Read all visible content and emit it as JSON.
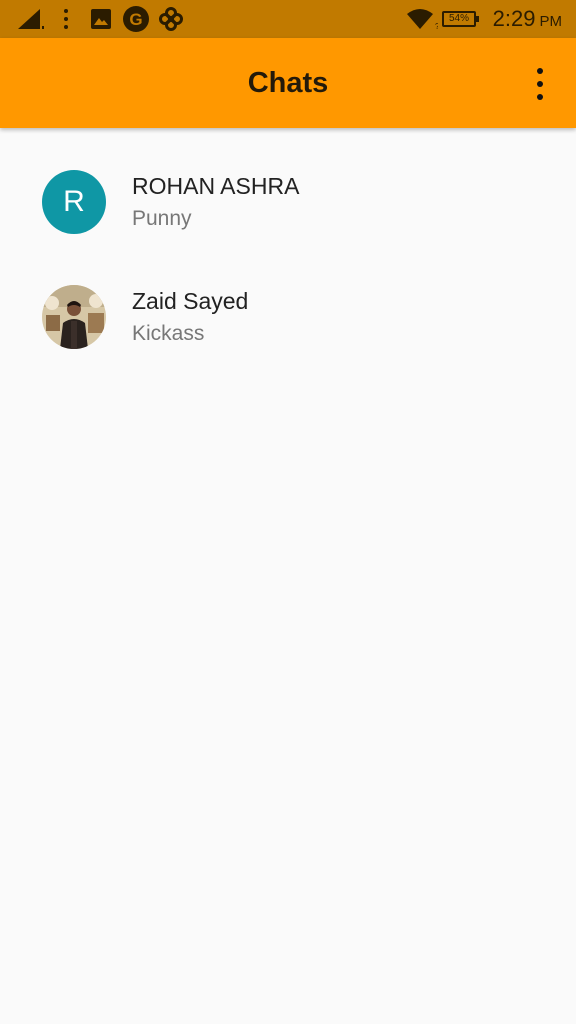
{
  "status_bar": {
    "time": "2:29",
    "ampm": "PM",
    "battery": "54%",
    "icons": [
      "signal-icon",
      "more-vert-icon",
      "image-icon",
      "google-icon",
      "pinwheel-icon",
      "wifi-icon",
      "battery-icon"
    ]
  },
  "app_bar": {
    "title": "Chats",
    "menu_icon": "overflow-menu-icon"
  },
  "chats": [
    {
      "name": "ROHAN ASHRA",
      "subtitle": "Punny",
      "avatar_type": "letter",
      "avatar_letter": "R",
      "avatar_color": "#0f97a5"
    },
    {
      "name": "Zaid Sayed",
      "subtitle": "Kickass",
      "avatar_type": "photo"
    }
  ],
  "colors": {
    "status_bar": "#c17a00",
    "app_bar": "#ff9800",
    "background": "#fafafa"
  }
}
